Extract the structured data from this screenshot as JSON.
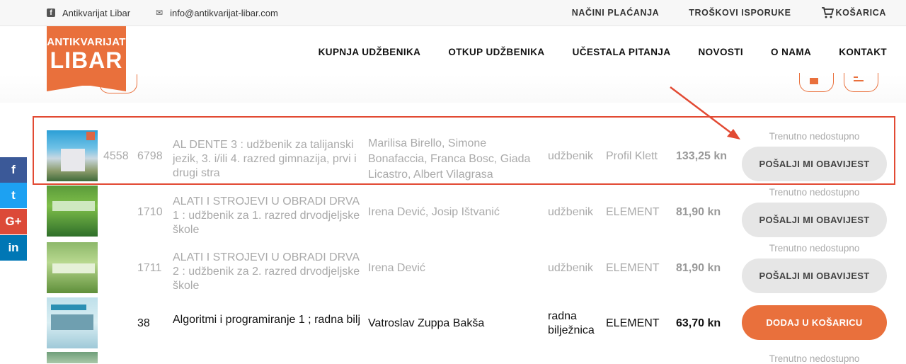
{
  "topbar": {
    "facebook_label": "Antikvarijat Libar",
    "email": "info@antikvarijat-libar.com",
    "links": [
      "NAČINI PLAĆANJA",
      "TROŠKOVI ISPORUKE"
    ],
    "cart_label": "KOŠARICA"
  },
  "logo": {
    "line1": "ANTIKVARIJAT",
    "line2": "LIBAR"
  },
  "nav": {
    "items": [
      "KUPNJA UDŽBENIKA",
      "OTKUP UDŽBENIKA",
      "UČESTALA PITANJA",
      "NOVOSTI",
      "O NAMA",
      "KONTAKT"
    ]
  },
  "social": {
    "facebook": "f",
    "twitter": "t",
    "googleplus": "G+",
    "linkedin": "in"
  },
  "colors": {
    "accent": "#e9703c",
    "highlight": "#e24a33",
    "facebook": "#3b5998",
    "twitter": "#1da1f2",
    "googleplus": "#dc4a38",
    "linkedin": "#0077b5"
  },
  "rows": [
    {
      "id": "4558",
      "code": "6798",
      "title": "AL DENTE 3 : udžbenik za talijanski jezik, 3. i/ili 4. razred gimnazija, prvi i drugi stra",
      "authors": "Marilisa Birello, Simone Bonafaccia, Franca Bosc, Giada Licastro, Albert Vilagrasa",
      "type": "udžbenik",
      "publisher": "Profil Klett",
      "price": "133,25 kn",
      "status": "Trenutno nedostupno",
      "button": "POŠALJI MI OBAVIJEST",
      "available": false
    },
    {
      "id": "",
      "code": "1710",
      "title": "ALATI I STROJEVI U OBRADI DRVA 1 : udžbenik za 1. razred drvodjeljske škole",
      "authors": "Irena Dević, Josip Ištvanić",
      "type": "udžbenik",
      "publisher": "ELEMENT",
      "price": "81,90 kn",
      "status": "Trenutno nedostupno",
      "button": "POŠALJI MI OBAVIJEST",
      "available": false
    },
    {
      "id": "",
      "code": "1711",
      "title": "ALATI I STROJEVI U OBRADI DRVA 2 : udžbenik za 2. razred drvodjeljske škole",
      "authors": "Irena Dević",
      "type": "udžbenik",
      "publisher": "ELEMENT",
      "price": "81,90 kn",
      "status": "Trenutno nedostupno",
      "button": "POŠALJI MI OBAVIJEST",
      "available": false
    },
    {
      "id": "",
      "code": "38",
      "title": "Algoritmi i programiranje 1 ; radna bilj",
      "authors": "Vatroslav Zuppa Bakša",
      "type": "radna bilježnica",
      "publisher": "ELEMENT",
      "price": "63,70 kn",
      "status": "",
      "button": "DODAJ U KOŠARICU",
      "available": true
    },
    {
      "status": "Trenutno nedostupno"
    }
  ]
}
